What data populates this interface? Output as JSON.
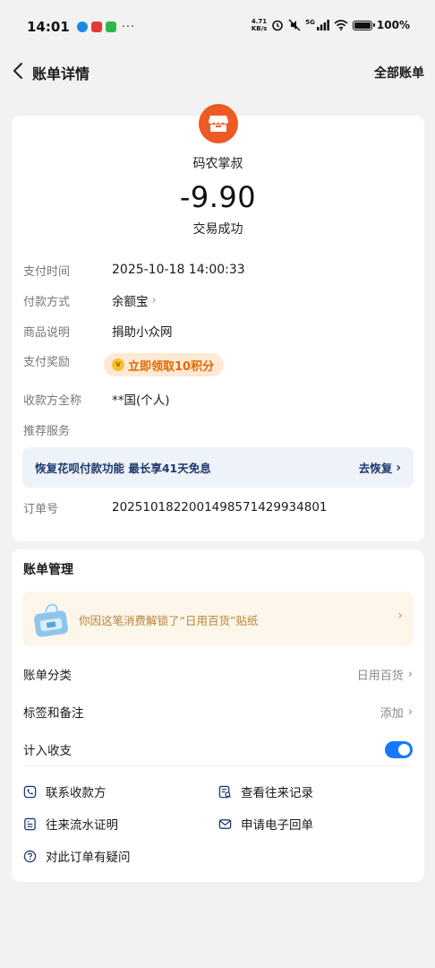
{
  "status_bar": {
    "time": "14:01",
    "more": "···",
    "speed_top": "4.71",
    "speed_bottom": "KB/s",
    "network": "5G",
    "battery": "100%"
  },
  "nav": {
    "title": "账单详情",
    "right_link": "全部账单"
  },
  "transaction": {
    "merchant_name": "码农掌叔",
    "amount": "-9.90",
    "status": "交易成功",
    "merchant_icon": "store-icon",
    "merchant_icon_color": "#ee5a24"
  },
  "details": [
    {
      "label": "支付时间",
      "value": "2025-10-18 14:00:33"
    },
    {
      "label": "付款方式",
      "value": "余额宝"
    },
    {
      "label": "商品说明",
      "value": "捐助小众网"
    },
    {
      "label": "支付奖励",
      "value": "立即领取10积分"
    },
    {
      "label": "收款方全称",
      "value": "**国(个人)"
    },
    {
      "label": "推荐服务",
      "value": ""
    },
    {
      "label": "订单号",
      "value": "2025101822001498571429934801"
    }
  ],
  "service_banner": {
    "text": "恢复花呗付款功能 最长享41天免息",
    "action": "去恢复"
  },
  "bill_management": {
    "title": "账单管理",
    "sticker_text": "你因这笔消费解锁了“日用百货”贴纸",
    "category_label": "账单分类",
    "category_value": "日用百货",
    "tags_label": "标签和备注",
    "tags_value": "添加",
    "count_label": "计入收支",
    "count_enabled": true
  },
  "actions": [
    {
      "label": "联系收款方",
      "icon": "phone-icon"
    },
    {
      "label": "查看往来记录",
      "icon": "records-icon"
    },
    {
      "label": "往来流水证明",
      "icon": "document-icon"
    },
    {
      "label": "申请电子回单",
      "icon": "mail-icon"
    },
    {
      "label": "对此订单有疑问",
      "icon": "help-icon"
    }
  ],
  "colors": {
    "accent_blue": "#1677ff",
    "reward_orange": "#e26a00",
    "service_blue": "#1d3a6e",
    "sticker_gold": "#b8833a"
  }
}
